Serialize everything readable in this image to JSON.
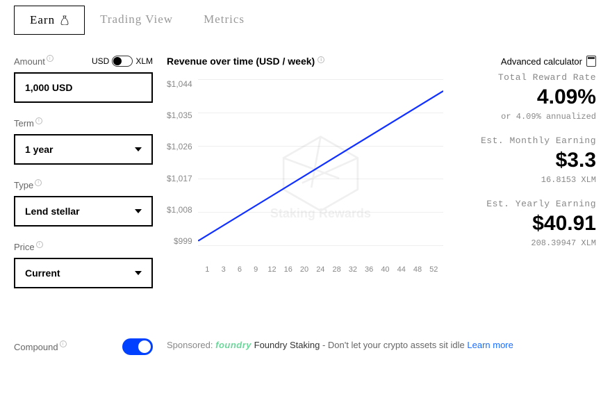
{
  "tabs": {
    "earn": "Earn",
    "trading": "Trading View",
    "metrics": "Metrics"
  },
  "form": {
    "amount_label": "Amount",
    "currency_left": "USD",
    "currency_right": "XLM",
    "amount_value": "1,000 USD",
    "term_label": "Term",
    "term_value": "1 year",
    "type_label": "Type",
    "type_value": "Lend stellar",
    "price_label": "Price",
    "price_value": "Current",
    "compound_label": "Compound"
  },
  "chart_title": "Revenue over time (USD / week)",
  "watermark_text": "Staking Rewards",
  "right": {
    "adv_label": "Advanced calculator",
    "total_label": "Total Reward Rate",
    "total_value": "4.09%",
    "total_sub": "or 4.09% annualized",
    "monthly_label": "Est. Monthly Earning",
    "monthly_value": "$3.3",
    "monthly_sub": "16.8153 XLM",
    "yearly_label": "Est. Yearly Earning",
    "yearly_value": "$40.91",
    "yearly_sub": "208.39947 XLM"
  },
  "sponsor": {
    "label": "Sponsored:",
    "logo": "foundry",
    "name": "Foundry Staking",
    "dash": "-",
    "text": "Don't let your crypto assets sit idle",
    "learn": "Learn more"
  },
  "chart_data": {
    "type": "line",
    "title": "Revenue over time (USD / week)",
    "xlabel": "week",
    "ylabel": "USD",
    "ylim": [
      999,
      1044
    ],
    "y_ticks": [
      1044,
      1035,
      1026,
      1017,
      1008,
      999
    ],
    "y_tick_labels": [
      "$1,044",
      "$1,035",
      "$1,026",
      "$1,017",
      "$1,008",
      "$999"
    ],
    "x_ticks": [
      1,
      3,
      6,
      9,
      12,
      16,
      20,
      24,
      28,
      32,
      36,
      40,
      44,
      48,
      52
    ],
    "series": [
      {
        "name": "Revenue",
        "x": [
          1,
          52
        ],
        "y": [
          1000,
          1041
        ]
      }
    ]
  }
}
